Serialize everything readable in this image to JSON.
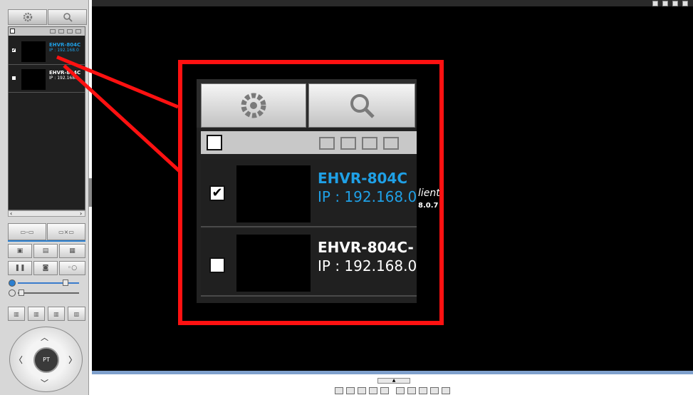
{
  "device_list": {
    "devices": [
      {
        "name": "EHVR-804C",
        "ip": "IP : 192.168.0",
        "checked": true,
        "selected_color": "#1fa0e6"
      },
      {
        "name": "EHVR-804C",
        "ip": "IP : 192.168.0",
        "checked": false
      }
    ],
    "checkmark": "✔"
  },
  "zoom_inset": {
    "devices": [
      {
        "name": "EHVR-804C",
        "ip": "IP : 192.168.0",
        "checked": true
      },
      {
        "name": "EHVR-804C-",
        "ip": "IP : 192.168.0",
        "checked": false
      }
    ],
    "overlay_text_1": "lient",
    "overlay_text_2": "8.0.7"
  },
  "ptz": {
    "center_label": "PT"
  },
  "icons": [
    "gear-icon",
    "search-icon",
    "device-group-icon",
    "add-device-icon",
    "delete-device-icon",
    "upload-device-icon",
    "connect-icon",
    "disconnect-icon",
    "pause-icon",
    "record-icon",
    "audio-icon",
    "volume-icon",
    "mic-icon"
  ],
  "colors": {
    "accent_blue": "#1fa0e6",
    "highlight_red": "#ff1111",
    "video_bg": "#000000"
  }
}
